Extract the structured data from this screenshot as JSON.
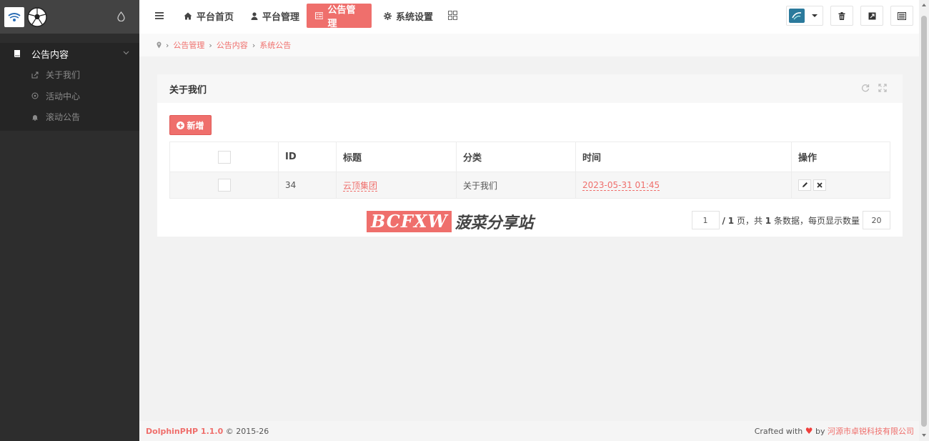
{
  "sidebar": {
    "group_label": "公告内容",
    "items": [
      {
        "label": "关于我们",
        "icon": "share-icon"
      },
      {
        "label": "活动中心",
        "icon": "circle-icon"
      },
      {
        "label": "滚动公告",
        "icon": "bell-icon"
      }
    ]
  },
  "header": {
    "nav": [
      {
        "label": "平台首页",
        "icon": "home-icon",
        "active": false
      },
      {
        "label": "平台管理",
        "icon": "user-icon",
        "active": false
      },
      {
        "label": "公告管理",
        "icon": "list-icon",
        "active": true
      },
      {
        "label": "系统设置",
        "icon": "gear-icon",
        "active": false
      }
    ]
  },
  "breadcrumb": [
    "公告管理",
    "公告内容",
    "系统公告"
  ],
  "block": {
    "title": "关于我们",
    "add_label": "新增"
  },
  "table": {
    "headers": [
      "ID",
      "标题",
      "分类",
      "时间",
      "操作"
    ],
    "rows": [
      {
        "id": "34",
        "title": "云顶集团",
        "category": "关于我们",
        "time": "2023-05-31 01:45"
      }
    ]
  },
  "watermark": {
    "box_text": "BCFXW",
    "text": "菠菜分享站"
  },
  "pager": {
    "current_page": "1",
    "page_text_prefix": "/",
    "total_pages": "1",
    "page_text_mid": "页，共",
    "total_rows": "1",
    "page_text_suffix": "条数据，每页显示数量",
    "page_size": "20"
  },
  "footer": {
    "brand": "DolphinPHP 1.1.0",
    "copyright": "© 2015-26",
    "crafted": "Crafted with",
    "by": "by",
    "company": "河源市卓锐科技有限公司"
  },
  "colors": {
    "accent": "#ef6f6c",
    "sidebar_bg": "#2d2d2d"
  }
}
